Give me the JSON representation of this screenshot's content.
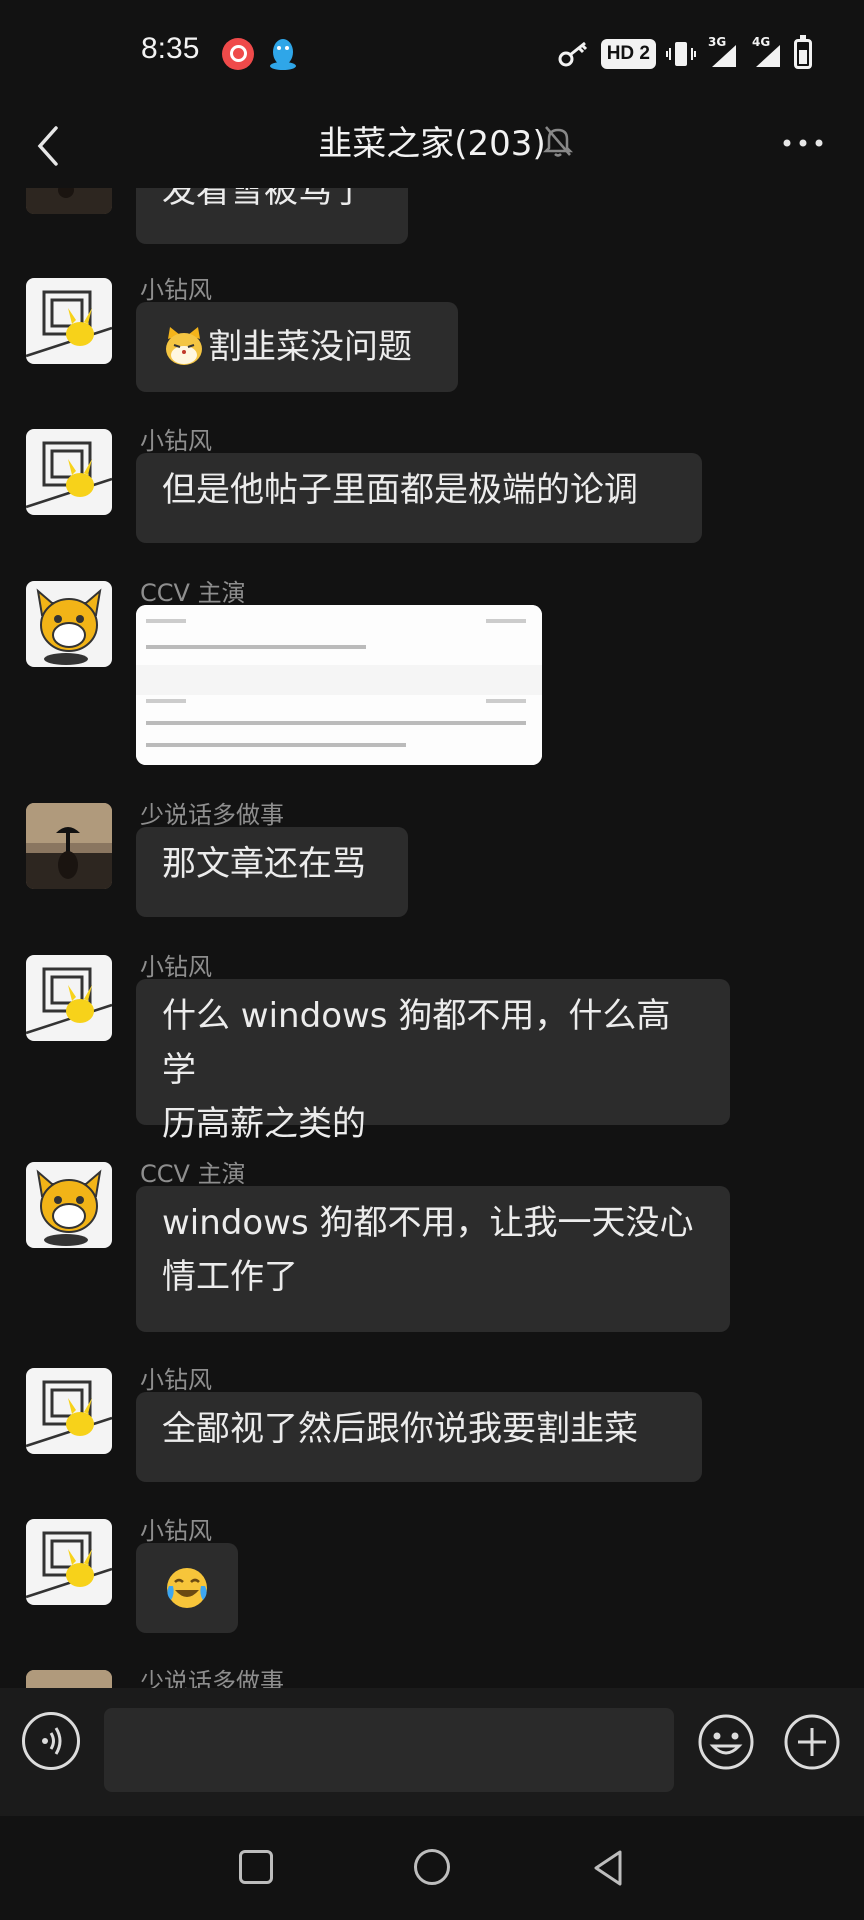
{
  "status_bar": {
    "time": "8:35",
    "hd_badge": "HD 2",
    "network_1": "3G",
    "network_2": "4G"
  },
  "header": {
    "title": "韭菜之家(203)"
  },
  "messages": [
    {
      "sender": "",
      "text": "发看雪被骂了",
      "avatar": "photo-avatar"
    },
    {
      "sender": "小钻风",
      "text": "割韭菜没问题",
      "emoji": "cat-face-emoji",
      "avatar": "pikachu-avatar"
    },
    {
      "sender": "小钻风",
      "text": "但是他帖子里面都是极端的论调",
      "avatar": "pikachu-avatar"
    },
    {
      "sender": "CCV 主演",
      "type": "image",
      "avatar": "tiger-avatar"
    },
    {
      "sender": "少说话多做事",
      "text": "那文章还在骂",
      "avatar": "photo-avatar"
    },
    {
      "sender": "小钻风",
      "line1": "什么 windows 狗都不用，什么高学",
      "line2": "历高薪之类的",
      "avatar": "pikachu-avatar"
    },
    {
      "sender": "CCV 主演",
      "line1": "windows 狗都不用，让我一天没心",
      "line2": "情工作了",
      "avatar": "tiger-avatar"
    },
    {
      "sender": "小钻风",
      "text": "全鄙视了然后跟你说我要割韭菜",
      "avatar": "pikachu-avatar"
    },
    {
      "sender": "小钻风",
      "emoji": "crying-laughing-emoji",
      "avatar": "pikachu-avatar"
    },
    {
      "sender": "少说话多做事",
      "avatar": "photo-avatar"
    }
  ],
  "input": {
    "placeholder": ""
  },
  "colors": {
    "background": "#121212",
    "bubble": "#2c2c2c",
    "input_bar": "#1b1b1b"
  }
}
